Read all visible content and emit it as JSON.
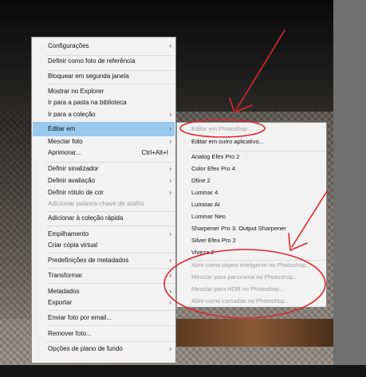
{
  "context_menu": {
    "items": [
      {
        "label": "Configurações",
        "arrow": "›",
        "disabled": false
      },
      {
        "label": "Definir como foto de referência",
        "disabled": false
      },
      {
        "label": "Bloquear em segunda janela",
        "disabled": false
      },
      {
        "label": "Mostrar no Explorer",
        "disabled": false
      },
      {
        "label": "Ir para a pasta na biblioteca",
        "disabled": false
      },
      {
        "label": "Ir para a coleção",
        "arrow": "›",
        "disabled": false
      },
      {
        "label": "Editar em",
        "arrow": "›",
        "disabled": false,
        "selected": true
      },
      {
        "label": "Mesclar foto",
        "arrow": "›",
        "disabled": false
      },
      {
        "label": "Aprimorar...",
        "shortcut": "Ctrl+Alt+I",
        "disabled": false
      },
      {
        "label": "Definir sinalizador",
        "arrow": "›",
        "disabled": false
      },
      {
        "label": "Definir avaliação",
        "arrow": "›",
        "disabled": false
      },
      {
        "label": "Definir rótulo de cor",
        "arrow": "›",
        "disabled": false
      },
      {
        "label": "Adicionar palavra-chave de atalho",
        "disabled": true
      },
      {
        "label": "Adicionar à coleção rápida",
        "disabled": false
      },
      {
        "label": "Empilhamento",
        "arrow": "›",
        "disabled": false
      },
      {
        "label": "Criar cópia virtual",
        "disabled": false
      },
      {
        "label": "Predefinições de metadados",
        "arrow": "›",
        "disabled": false
      },
      {
        "label": "Transformar",
        "arrow": "›",
        "disabled": false
      },
      {
        "label": "Metadados",
        "arrow": "›",
        "disabled": false
      },
      {
        "label": "Exportar",
        "arrow": "›",
        "disabled": false
      },
      {
        "label": "Enviar foto por email...",
        "disabled": false
      },
      {
        "label": "Remover foto...",
        "disabled": false
      },
      {
        "label": "Opções de plano de fundo",
        "arrow": "›",
        "disabled": false
      }
    ]
  },
  "submenu": {
    "items": [
      {
        "label": "Editar em Photoshop...",
        "disabled": true
      },
      {
        "label": "Editar em outro aplicativo...",
        "disabled": false
      },
      {
        "label": "Analog Efex Pro 2",
        "disabled": false
      },
      {
        "label": "Color Efex Pro 4",
        "disabled": false
      },
      {
        "label": "Dfine 2",
        "disabled": false
      },
      {
        "label": "Luminar 4",
        "disabled": false
      },
      {
        "label": "Luminar AI",
        "disabled": false
      },
      {
        "label": "Luminar Neo",
        "disabled": false
      },
      {
        "label": "Sharpener Pro 3: Output Sharpener",
        "disabled": false
      },
      {
        "label": "Silver Efex Pro 2",
        "disabled": false
      },
      {
        "label": "Viveza 2",
        "disabled": false
      },
      {
        "label": "Abrir como objeto inteligente no Photoshop...",
        "disabled": true
      },
      {
        "label": "Mesclar para panorama no Photoshop...",
        "disabled": true
      },
      {
        "label": "Mesclar para HDR no Photoshop...",
        "disabled": true
      },
      {
        "label": "Abrir como camadas no Photoshop...",
        "disabled": true
      }
    ]
  },
  "colors": {
    "highlight": "#99c9ef",
    "annotation_red": "#e0262b",
    "menu_bg": "#f2f2f2"
  }
}
